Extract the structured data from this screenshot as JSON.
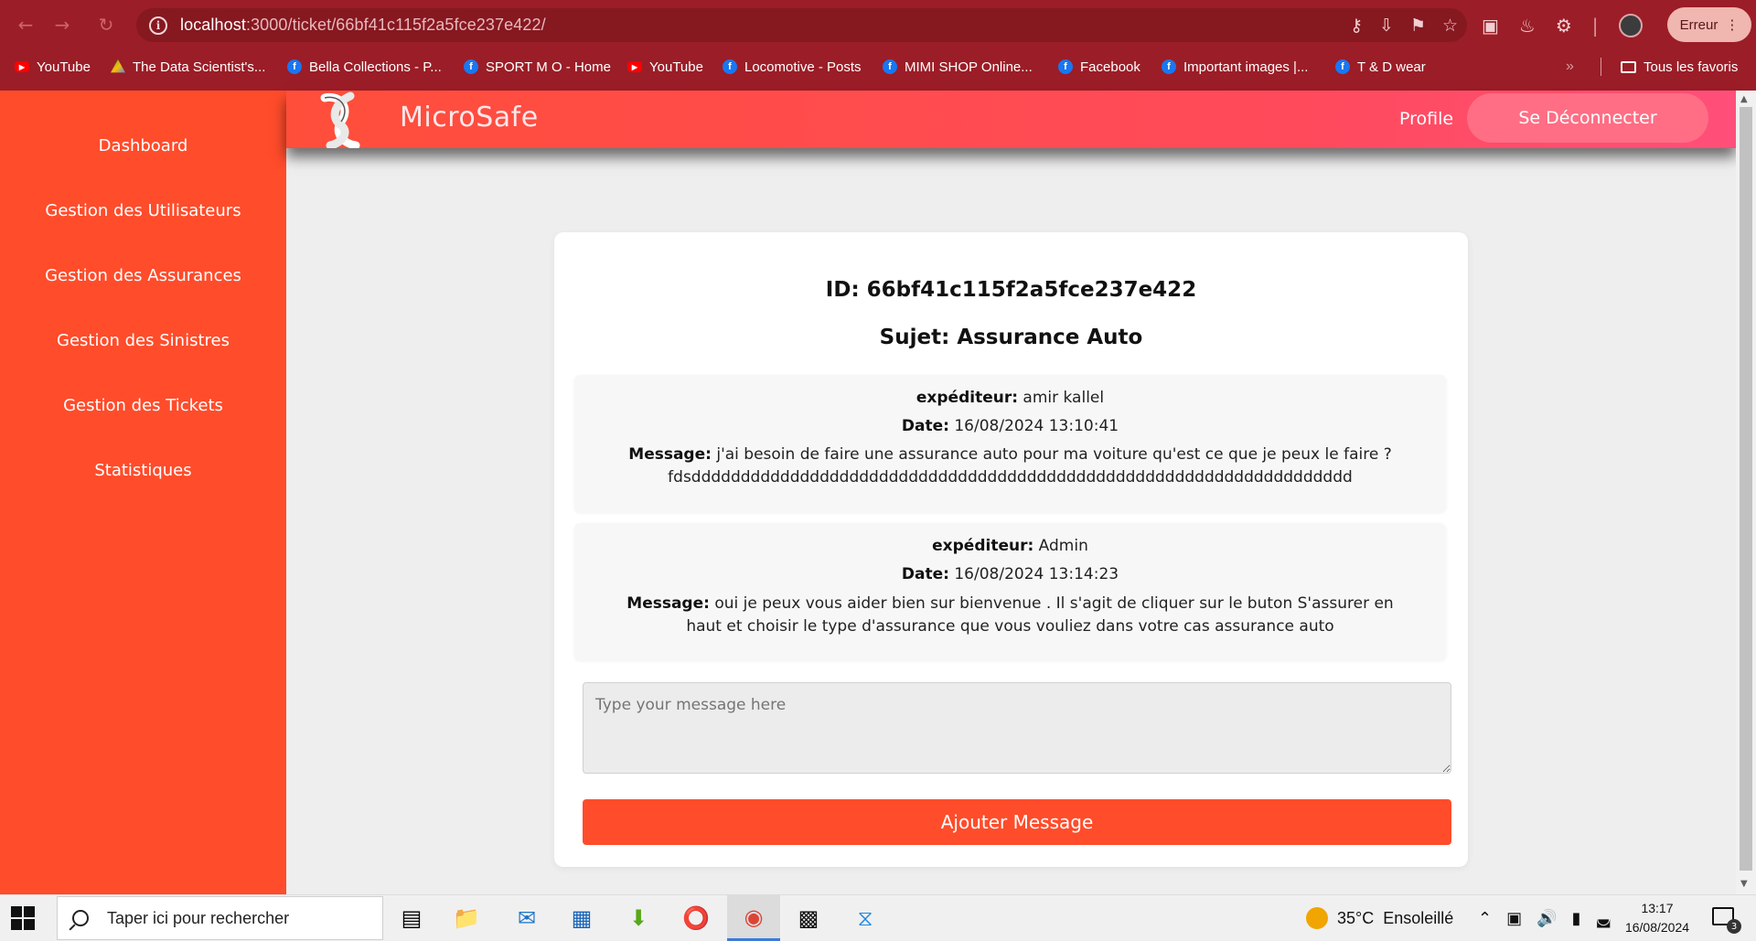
{
  "browser": {
    "url_host": "localhost",
    "url_rest": ":3000/ticket/66bf41c115f2a5fce237e422/",
    "profile_status": "Erreur",
    "bookmarks": [
      {
        "label": "YouTube",
        "icon": "youtube-icon"
      },
      {
        "label": "The Data Scientist's...",
        "icon": "google-drive-icon"
      },
      {
        "label": "Bella Collections - P...",
        "icon": "facebook-icon"
      },
      {
        "label": "SPORT M O - Home",
        "icon": "facebook-icon"
      },
      {
        "label": "YouTube",
        "icon": "youtube-icon"
      },
      {
        "label": "Locomotive - Posts",
        "icon": "facebook-icon"
      },
      {
        "label": "MIMI SHOP Online...",
        "icon": "facebook-icon"
      },
      {
        "label": "Facebook",
        "icon": "facebook-icon"
      },
      {
        "label": "Important images |...",
        "icon": "facebook-icon"
      },
      {
        "label": "T & D wear",
        "icon": "facebook-icon"
      }
    ],
    "more": "»",
    "all_bookmarks": "Tous les favoris"
  },
  "sidebar": {
    "items": [
      {
        "label": "Dashboard"
      },
      {
        "label": "Gestion des Utilisateurs"
      },
      {
        "label": "Gestion des Assurances"
      },
      {
        "label": "Gestion des Sinistres"
      },
      {
        "label": "Gestion des Tickets"
      },
      {
        "label": "Statistiques"
      }
    ]
  },
  "header": {
    "brand": "MicroSafe",
    "profile": "Profile",
    "logout": "Se Déconnecter"
  },
  "ticket": {
    "id_label": "ID:",
    "id_value": "66bf41c115f2a5fce237e422",
    "subject_label": "Sujet:",
    "subject_value": "Assurance Auto",
    "messages": [
      {
        "sender_label": "expéditeur:",
        "sender": "amir kallel",
        "date_label": "Date:",
        "date": "16/08/2024 13:10:41",
        "message_label": "Message:",
        "message_line1": "j'ai besoin de faire une assurance auto pour ma voiture qu'est ce que je peux le faire ?",
        "message_line2": "fdsddddddddddddddddddddddddddddddddddddddddddddddddddddddddddddddddddd"
      },
      {
        "sender_label": "expéditeur:",
        "sender": "Admin",
        "date_label": "Date:",
        "date": "16/08/2024 13:14:23",
        "message_label": "Message:",
        "message_line1": "oui je peux vous aider bien sur bienvenue . Il s'agit de cliquer sur le buton S'assurer en",
        "message_line2": "haut et choisir le type d'assurance que vous vouliez dans votre cas assurance auto"
      }
    ],
    "input_placeholder": "Type your message here",
    "submit": "Ajouter Message"
  },
  "taskbar": {
    "search_placeholder": "Taper ici pour rechercher",
    "weather_temp": "35°C",
    "weather_text": "Ensoleillé",
    "time": "13:17",
    "date": "16/08/2024",
    "notifications": "3"
  },
  "colors": {
    "accent": "#ff4c2b",
    "browser": "#9b1d27"
  }
}
